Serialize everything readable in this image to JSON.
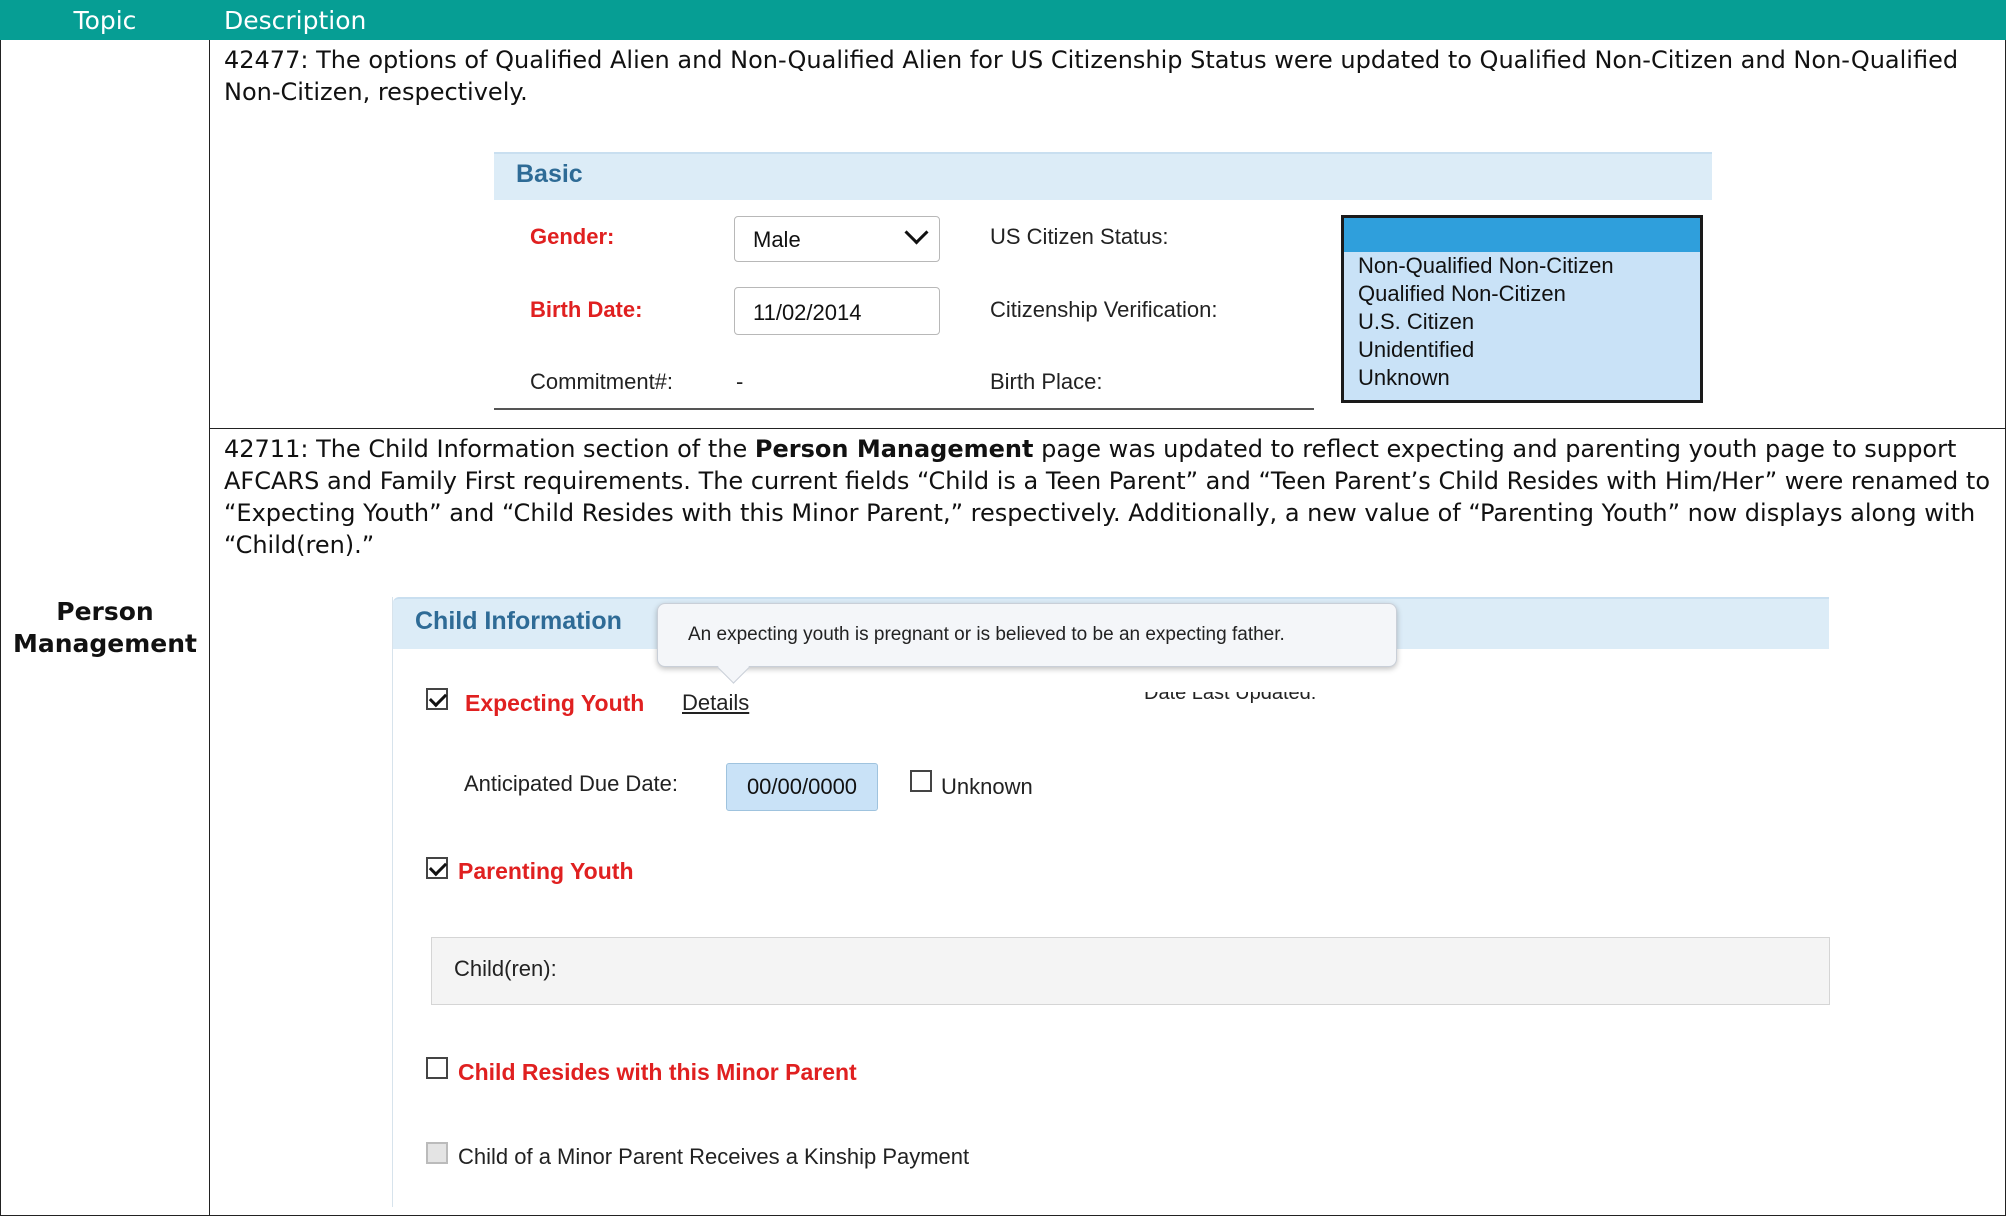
{
  "table": {
    "header_topic": "Topic",
    "header_description": "Description"
  },
  "row": {
    "topic": "Person Management",
    "item1_text": "42477: The options of Qualified Alien and Non-Qualified Alien for US Citizenship Status were updated to Qualified Non-Citizen and Non-Qualified Non-Citizen, respectively.",
    "item2_text_before": "42711: The Child Information section of the ",
    "item2_bold": "Person Management",
    "item2_text_after": " page was updated to reflect expecting and parenting youth page to support AFCARS and Family First requirements. The current fields “Child is a Teen Parent” and “Teen Parent’s Child Resides with Him/Her” were renamed to “Expecting Youth” and “Child Resides with this Minor Parent,” respectively. Additionally, a new value of “Parenting Youth” now displays along with “Child(ren).”"
  },
  "basic_panel": {
    "title": "Basic",
    "gender_label": "Gender:",
    "gender_value": "Male",
    "birth_date_label": "Birth Date:",
    "birth_date_value": "11/02/2014",
    "commitment_label": "Commitment#:",
    "commitment_value": "-",
    "us_citizen_label": "US Citizen Status:",
    "citizenship_verification_label": "Citizenship Verification:",
    "birth_place_label": "Birth Place:",
    "citizen_options": [
      "Non-Qualified Non-Citizen",
      "Qualified Non-Citizen",
      "U.S. Citizen",
      "Unidentified",
      "Unknown"
    ]
  },
  "child_panel": {
    "title": "Child Information",
    "tooltip": "An expecting youth is pregnant or is believed to be an expecting father.",
    "expecting_youth_label": "Expecting Youth",
    "details_link": "Details",
    "date_last_updated": "Date Last Updated:",
    "anticipated_due_date_label": "Anticipated Due Date:",
    "anticipated_due_date_value": "00/00/0000",
    "unknown_label": "Unknown",
    "parenting_youth_label": "Parenting Youth",
    "children_label": "Child(ren):",
    "child_resides_label": "Child Resides with this Minor Parent",
    "kinship_label": "Child of a Minor Parent Receives a Kinship Payment"
  },
  "colors": {
    "header_teal": "#069e94",
    "required_red": "#e02020",
    "panel_header_blue": "#dcecf7",
    "selection_blue": "#2f9fdc"
  }
}
